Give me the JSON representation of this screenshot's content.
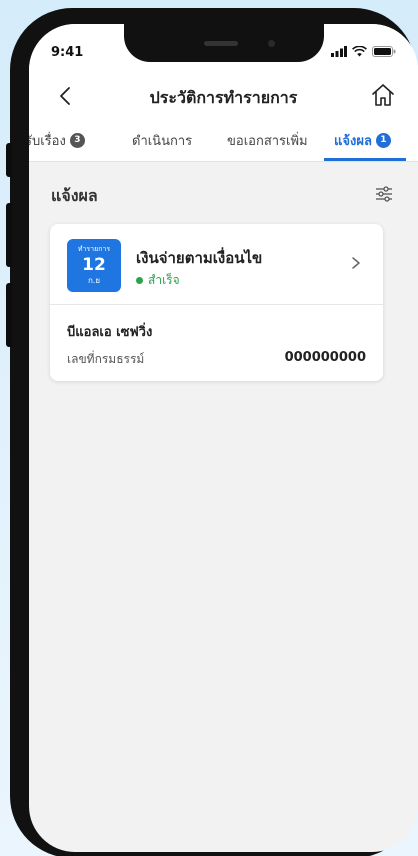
{
  "status": {
    "time": "9:41"
  },
  "nav": {
    "title": "ประวัติการทำรายการ"
  },
  "tabs": [
    {
      "label": "รับเรื่อง",
      "badge": "3",
      "active": false
    },
    {
      "label": "ดำเนินการ",
      "badge": "",
      "active": false
    },
    {
      "label": "ขอเอกสารเพิ่ม",
      "badge": "",
      "active": false
    },
    {
      "label": "แจ้งผล",
      "badge": "1",
      "active": true
    }
  ],
  "section": {
    "title": "แจ้งผล"
  },
  "card": {
    "date_top": "ทำรายการ",
    "date_day": "12",
    "date_month": "ก.ย",
    "title": "เงินจ่ายตามเงื่อนไข",
    "status": "สำเร็จ",
    "company": "บีแอลเอ เซฟวิ่ง",
    "ref_label": "เลขที่กรมธรรม์",
    "ref_value": "000000000"
  },
  "colors": {
    "accent": "#1f6fd6",
    "success": "#2aa34a",
    "badge_inactive": "#555555"
  }
}
